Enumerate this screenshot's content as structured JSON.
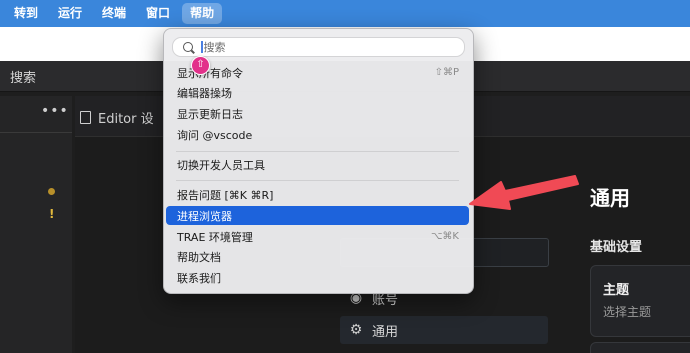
{
  "menubar": {
    "items": [
      {
        "label": "转到"
      },
      {
        "label": "运行"
      },
      {
        "label": "终端"
      },
      {
        "label": "窗口"
      },
      {
        "label": "帮助"
      }
    ]
  },
  "window": {
    "search_title": "搜索",
    "editor_tab_label": "Editor 设"
  },
  "settings": {
    "nav_items": [
      {
        "label": "账号",
        "icon": "account-icon"
      },
      {
        "label": "通用",
        "icon": "gear-icon"
      }
    ],
    "heading": "通用",
    "section_title": "基础设置",
    "card_title": "主题",
    "card_subtitle": "选择主题"
  },
  "help_menu": {
    "search_placeholder": "搜索",
    "items": [
      {
        "label": "显示所有命令",
        "shortcut": "⇧⌘P"
      },
      {
        "label": "编辑器操场",
        "shortcut": ""
      },
      {
        "label": "显示更新日志",
        "shortcut": ""
      },
      {
        "label": "询问 @vscode",
        "shortcut": ""
      },
      {
        "label": "切换开发人员工具",
        "shortcut": ""
      },
      {
        "label": "报告问题 [⌘K ⌘R]",
        "shortcut": ""
      },
      {
        "label": "进程浏览器",
        "shortcut": "",
        "highlighted": true
      },
      {
        "label": "TRAE 环境管理",
        "shortcut": "⌥⌘K"
      },
      {
        "label": "帮助文档",
        "shortcut": ""
      },
      {
        "label": "联系我们",
        "shortcut": ""
      }
    ]
  },
  "annotation": {
    "arrow_color": "#f04a55",
    "cursor_badge_color": "#e2318a"
  },
  "colors": {
    "menubar": "#3a86db",
    "highlight": "#1d63dc"
  }
}
